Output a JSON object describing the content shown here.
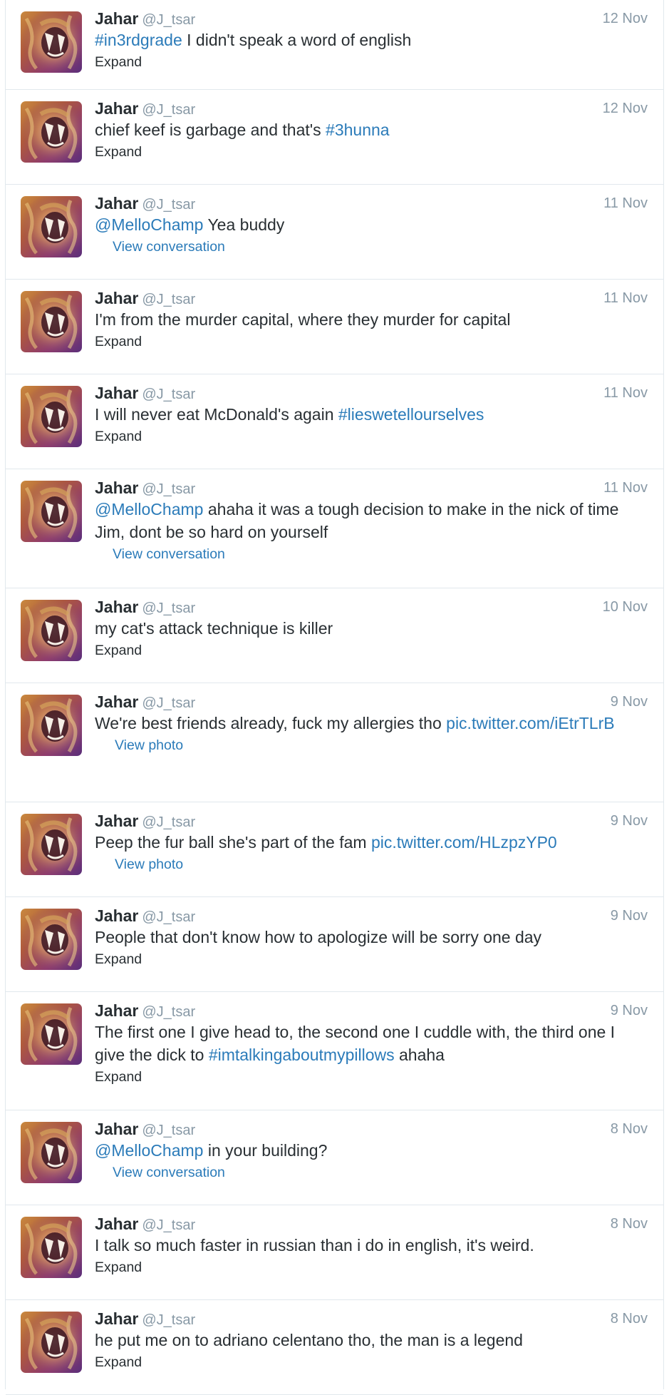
{
  "user": {
    "name": "Jahar",
    "handle": "@J_tsar"
  },
  "colors": {
    "link": "#2b7bb9",
    "meta": "#8899a6",
    "text": "#292f33",
    "divider": "#e1e8ed"
  },
  "tweets": [
    {
      "date": "12 Nov",
      "segments": [
        [
          "#in3rdgrade",
          true
        ],
        [
          " I didn't speak a word of english",
          false
        ]
      ],
      "action": "Expand"
    },
    {
      "date": "12 Nov",
      "segments": [
        [
          "chief keef is garbage and that's ",
          false
        ],
        [
          "#3hunna",
          true
        ]
      ],
      "action": "Expand"
    },
    {
      "date": "11 Nov",
      "segments": [
        [
          "@MelloChamp",
          true
        ],
        [
          " Yea buddy",
          false
        ]
      ],
      "action": "View conversation"
    },
    {
      "date": "11 Nov",
      "segments": [
        [
          "I'm from the murder capital, where they murder for capital",
          false
        ]
      ],
      "action": "Expand"
    },
    {
      "date": "11 Nov",
      "segments": [
        [
          "I will never eat McDonald's again ",
          false
        ],
        [
          "#lieswetellourselves",
          true
        ]
      ],
      "action": "Expand"
    },
    {
      "date": "11 Nov",
      "segments": [
        [
          "@MelloChamp",
          true
        ],
        [
          " ahaha it was a tough decision to make in the nick of time Jim, dont be so hard on yourself",
          false
        ]
      ],
      "action": "View conversation"
    },
    {
      "date": "10 Nov",
      "segments": [
        [
          "my cat's attack technique is killer",
          false
        ]
      ],
      "action": "Expand"
    },
    {
      "date": "9 Nov",
      "segments": [
        [
          "We're best friends already, fuck my allergies tho ",
          false
        ],
        [
          "pic.twitter.com/iEtrTLrB",
          true
        ]
      ],
      "action": "View photo"
    },
    {
      "date": "9 Nov",
      "segments": [
        [
          "Peep the fur ball she's part of the fam ",
          false
        ],
        [
          "pic.twitter.com/HLzpzYP0",
          true
        ]
      ],
      "action": "View photo"
    },
    {
      "date": "9 Nov",
      "segments": [
        [
          "People that don't know how to apologize will be sorry one day",
          false
        ]
      ],
      "action": "Expand"
    },
    {
      "date": "9 Nov",
      "segments": [
        [
          "The first one I give head to, the second one I cuddle with, the third one I give the dick to ",
          false
        ],
        [
          "#imtalkingaboutmypillows",
          true
        ],
        [
          " ahaha",
          false
        ]
      ],
      "action": "Expand"
    },
    {
      "date": "8 Nov",
      "segments": [
        [
          "@MelloChamp",
          true
        ],
        [
          " in your building?",
          false
        ]
      ],
      "action": "View conversation"
    },
    {
      "date": "8 Nov",
      "segments": [
        [
          "I talk so much faster in russian than i do in english, it's weird.",
          false
        ]
      ],
      "action": "Expand"
    },
    {
      "date": "8 Nov",
      "segments": [
        [
          "he put me on to adriano celentano tho, the man is a legend",
          false
        ]
      ],
      "action": "Expand"
    }
  ]
}
